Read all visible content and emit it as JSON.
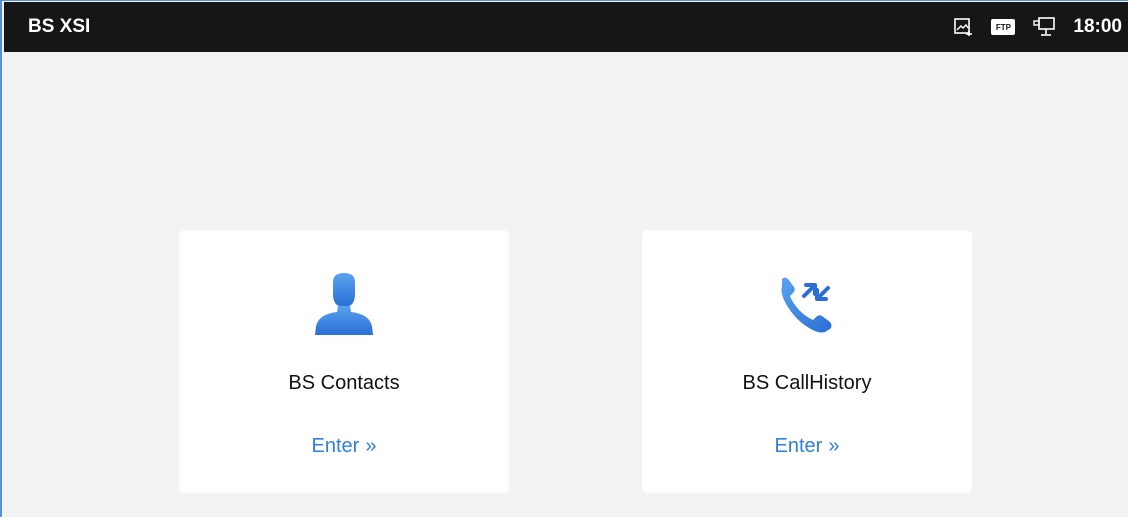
{
  "statusbar": {
    "app_title": "BS XSI",
    "icons": [
      "screenshot-icon",
      "ftp-icon",
      "network-icon"
    ],
    "ftp_label": "FTP",
    "time": "18:00"
  },
  "cards": [
    {
      "title": "BS Contacts",
      "enter_label": "Enter",
      "icon": "contact-person-icon"
    },
    {
      "title": "BS CallHistory",
      "enter_label": "Enter",
      "icon": "call-history-icon"
    }
  ],
  "colors": {
    "accent": "#2f7fe0",
    "statusbar": "#161616",
    "background": "#f2f3f3"
  }
}
